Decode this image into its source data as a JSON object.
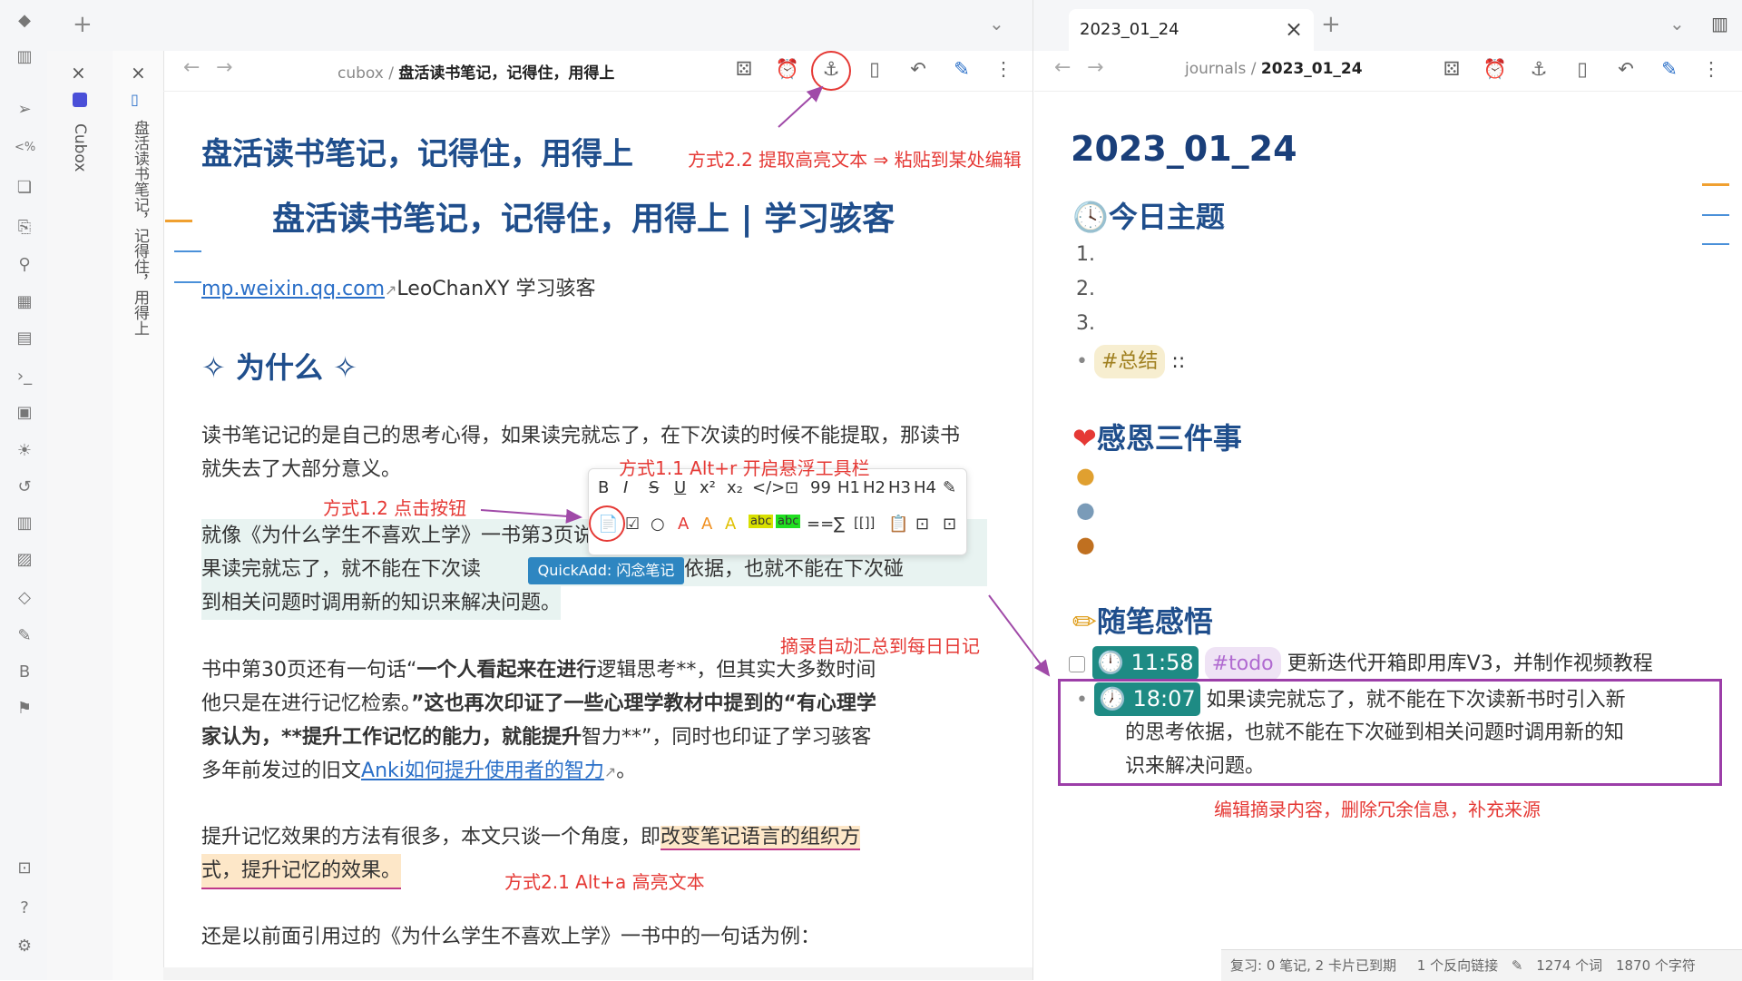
{
  "left_tab": {
    "new_tab_label": "+"
  },
  "right_tab": {
    "title": "2023_01_24",
    "close": "×",
    "new_tab_label": "+"
  },
  "stack": {
    "cubox_label": "Cubox",
    "note_vertical": "盘活读书笔记，记得住，用得上"
  },
  "left_pane": {
    "breadcrumb_parent": "cubox",
    "breadcrumb_sep": "/",
    "breadcrumb_current": "盘活读书笔记，记得住，用得上",
    "title": "盘活读书笔记，记得住，用得上",
    "heading2": "盘活读书笔记，记得住，用得上 | 学习骇客",
    "source_link": "mp.weixin.qq.com",
    "source_author": "LeoChanXY 学习骇客",
    "section_heading": "✧ 为什么 ✧",
    "para1": "读书笔记记的是自己的思考心得，如果读完就忘了，在下次读的时候不能提取，那读书就失去了大部分意义。",
    "para2_line1": "就像《为什么学生不喜欢上学》一书第3页说的“事实性知识要先于技能”。如",
    "para2_line2a": "果读完就忘了，就不能在下次读",
    "para2_line2b": "思考依据，也就不能在下次碰",
    "para2_line3": "到相关问题时调用新的知识来解决问题。",
    "para3_line1a": "书中第30页还有一句话“",
    "para3_line1b": "一个人看起来在进行",
    "para3_line1c": "逻辑思考**，但其实大多数时间",
    "para3_line2": "他只是在进行记忆检索。",
    "para3_line2b": "”这也再次印证了一些心理学教材中提到的“有心理学",
    "para3_line3a": "家认为，**提升工作记忆的能力，就能提升",
    "para3_line3b": "智力**”，同时也印证了学习骇客",
    "para3_line4a": "多年前发过的旧文",
    "para3_line4link": "Anki如何提升使用者的智力",
    "para3_line4b": "。",
    "para4_line1a": "提升记忆效果的方法有很多，本文只谈一个角度，即",
    "para4_line1b": "改变笔记语言的组织方",
    "para4_line2": "式，提升记忆的效果。",
    "para5": "还是以前面引用过的《为什么学生不喜欢上学》一书中的一句话为例："
  },
  "floating_toolbar": {
    "row1": [
      "B",
      "I",
      "S",
      "U",
      "x²",
      "x₂",
      "</>",
      "⊡",
      "99",
      "H1",
      "H2",
      "H3",
      "H4",
      "✎"
    ],
    "row2": [
      "📄",
      "☑",
      "○",
      "A",
      "A",
      "A",
      "abc",
      "abc",
      "==",
      "∑",
      "[[]]",
      "📋",
      "⊡",
      "⊡"
    ],
    "tooltip": "QuickAdd: 闪念笔记"
  },
  "annotations": {
    "a1": "方式2.2 提取高亮文本 ⇒ 粘贴到某处编辑",
    "a2": "方式1.1 Alt+r 开启悬浮工具栏",
    "a3": "方式1.2 点击按钮",
    "a4": "摘录自动汇总到每日日记",
    "a5": "方式2.1 Alt+a 高亮文本",
    "a6": "编辑摘录内容，删除冗余信息，补充来源"
  },
  "right_pane": {
    "breadcrumb_parent": "journals",
    "breadcrumb_sep": "/",
    "breadcrumb_current": "2023_01_24",
    "title": "2023_01_24",
    "h_theme": "今日主题",
    "list": [
      "1.",
      "2.",
      "3."
    ],
    "summary_tag": "#总结",
    "summary_suffix": " ::",
    "h_thanks": "感恩三件事",
    "h_notes": "随笔感悟",
    "todo_time": "11:58",
    "todo_tag": "#todo",
    "todo_text": "更新迭代开箱即用库V3，并制作视频教程",
    "entry_time": "18:07",
    "entry_line1": "如果读完就忘了，就不能在下次读新书时引入新",
    "entry_line2": "的思考依据，也就不能在下次碰到相关问题时调用新的知",
    "entry_line3": "识来解决问题。"
  },
  "statusbar": {
    "review": "复习: 0 笔记, 2 卡片已到期",
    "backlinks": "1 个反向链接",
    "words": "1274 个词",
    "chars": "1870 个字符"
  },
  "colors": {
    "heading": "#1f4e8c",
    "annotation": "#e53935",
    "accent": "#2a6fc8",
    "time_badge": "#1e8b84"
  }
}
